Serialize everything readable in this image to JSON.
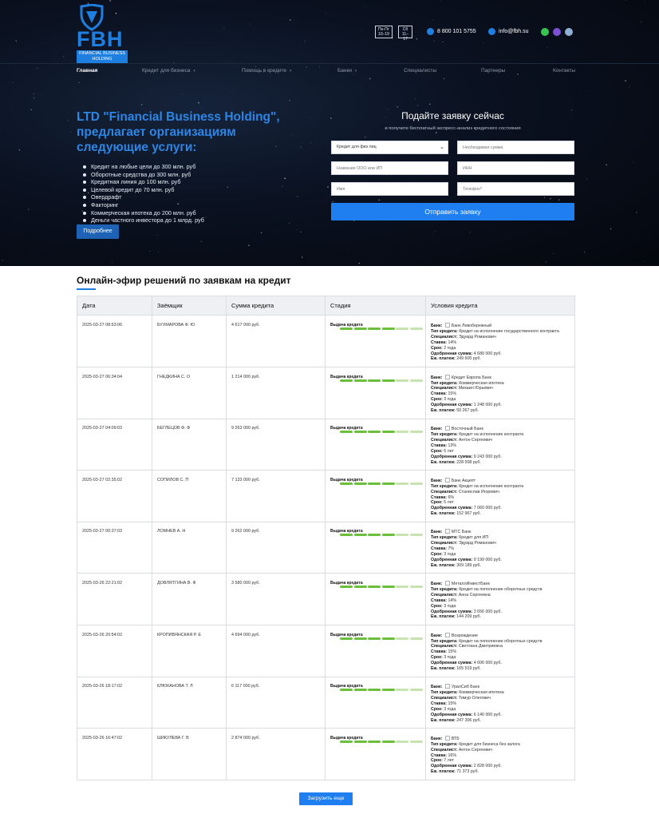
{
  "brand": {
    "logo_text": "FBH",
    "logo_sub": "FINANCIAL BUSINESS HOLDING",
    "accent": "#1f7fe0"
  },
  "header": {
    "hours_weekday_days": "Пн-Пт",
    "hours_weekday_time": "10–19",
    "hours_sat_days": "Сб",
    "hours_sat_time": "11–17",
    "phone": "8 800 101 5755",
    "email": "info@fbh.su",
    "social_icons": [
      "whatsapp-icon",
      "viber-icon",
      "telegram-icon"
    ]
  },
  "nav": {
    "items": [
      {
        "label": "Главная"
      },
      {
        "label": "Кредит для бизнеса"
      },
      {
        "label": "Помощь в кредите"
      },
      {
        "label": "Банки"
      },
      {
        "label": "Специалисты"
      },
      {
        "label": "Партнеры"
      },
      {
        "label": "Контакты"
      }
    ]
  },
  "hero": {
    "title": "LTD \"Financial Business Holding\", предлагает организациям следующие услуги:",
    "services": [
      "Кредит на любые цели до 300 млн. руб",
      "Оборотные средства до 300 млн. руб",
      "Кредитная линия до 100 млн. руб",
      "Целевой кредит до 70 млн. руб",
      "Овердрафт",
      "Факторинг",
      "Коммерческая ипотека до 200 млн. руб",
      "Деньги частного инвестора до 1 млрд. руб"
    ],
    "more_button": "Подробнее"
  },
  "form": {
    "title": "Подайте заявку сейчас",
    "subtitle": "и получите бесплатный экспресс-анализ кредитного состояния",
    "credit_type_value": "Кредит для физ лиц",
    "amount_placeholder": "Необходимая сумма",
    "company_placeholder": "Название ООО или ИП",
    "inn_placeholder": "ИНН",
    "name_placeholder": "Имя",
    "phone_placeholder": "Телефон*",
    "submit_label": "Отправить заявку"
  },
  "feed": {
    "title": "Онлайн-эфир решений по заявкам на кредит",
    "columns": [
      "Дата",
      "Заёмщик",
      "Сумма кредита",
      "Стадия",
      "Условия кредита"
    ],
    "labels": {
      "bank": "Банк:",
      "type": "Тип кредита:",
      "specialist": "Специалист:",
      "rate": "Ставка:",
      "term": "Срок:",
      "approved": "Одобренная сумма:",
      "payment": "Еж. платеж:"
    },
    "rows": [
      {
        "date": "2025-03-27 08:53:06",
        "borrower": "БУХМАРОВА Ф. Ю",
        "amount": "4 617 000 руб.",
        "stage": "Выдача кредита",
        "bank": "Банк Левобережный",
        "type": "Кредит на исполнение государственного контракта",
        "specialist": "Эдуард Романович",
        "rate": "14%",
        "term": "2 года",
        "approved": "4 680 000 руб.",
        "payment": "249 600 руб."
      },
      {
        "date": "2025-03-27 06:34:04",
        "borrower": "ГНЕДКИНА С. О",
        "amount": "1 214 000 руб.",
        "stage": "Выдача кредита",
        "bank": "Кредит Европа Банк",
        "type": "Коммерческая ипотека",
        "specialist": "Михаил Юрьевич",
        "rate": "15%",
        "term": "3 года",
        "approved": "1 248 000 руб.",
        "payment": "50 267 руб."
      },
      {
        "date": "2025-03-27 04:09:03",
        "borrower": "БЕГЛЕЦОВ Ф. Ф",
        "amount": "9 263 000 руб.",
        "stage": "Выдача кредита",
        "bank": "Восточный Банк",
        "type": "Кредит на исполнение контракта",
        "specialist": "Антон Сергеевич",
        "rate": "13%",
        "term": "6 лет",
        "approved": "9 243 000 руб.",
        "payment": "228 508 руб."
      },
      {
        "date": "2025-03-27 02:35:02",
        "borrower": "СОПИЛОВ С. П",
        "amount": "7 133 000 руб.",
        "stage": "Выдача кредита",
        "bank": "Банк Акцепт",
        "type": "Кредит на исполнение контракта",
        "specialist": "Станислав Игоревич",
        "rate": "6%",
        "term": "5 лет",
        "approved": "7 060 000 руб.",
        "payment": "152 967 руб."
      },
      {
        "date": "2025-03-27 00:37:03",
        "borrower": "ЛОМНЕВ А. Н",
        "amount": "9 262 000 руб.",
        "stage": "Выдача кредита",
        "bank": "МТС Банк",
        "type": "Кредит для ИП",
        "specialist": "Эдуард Романович",
        "rate": "7%",
        "term": "3 года",
        "approved": "9 199 000 руб.",
        "payment": "309 189 руб."
      },
      {
        "date": "2025-03-26 22:21:02",
        "borrower": "ДОВЛЯТГИНА В. Ф",
        "amount": "3 580 000 руб.",
        "stage": "Выдача кредита",
        "bank": "МеталлИнвестБанк",
        "type": "Кредит на пополнение оборотных средств",
        "specialist": "Анна Сергеевна",
        "rate": "14%",
        "term": "3 года",
        "approved": "3 656 000 руб.",
        "payment": "144 209 руб."
      },
      {
        "date": "2025-03-26 20:54:02",
        "borrower": "КРОПИВЯНСКАЯ Р. Е",
        "amount": "4 694 000 руб.",
        "stage": "Выдача кредита",
        "bank": "Возрождение",
        "type": "Кредит на пополнение оборотных средств",
        "specialist": "Светлана Дмитриевна",
        "rate": "15%",
        "term": "3 года",
        "approved": "4 606 000 руб.",
        "payment": "165 519 руб."
      },
      {
        "date": "2025-03-26 18:17:02",
        "borrower": "КЛЮКАНОВА Т. Л",
        "amount": "6 117 000 руб.",
        "stage": "Выдача кредита",
        "bank": "УралСиб Банк",
        "type": "Коммерческая ипотека",
        "specialist": "Тимур Олегович",
        "rate": "15%",
        "term": "3 года",
        "approved": "6 140 000 руб.",
        "payment": "247 306 руб."
      },
      {
        "date": "2025-03-26 16:47:02",
        "borrower": "ШИКУЛЕВА Г. В",
        "amount": "2 874 000 руб.",
        "stage": "Выдача кредита",
        "bank": "ВТБ",
        "type": "Кредит для бизнеса без залога",
        "specialist": "Антон Сергеевич",
        "rate": "16%",
        "term": "7 лет",
        "approved": "2 828 000 руб.",
        "payment": "71 373 руб."
      }
    ],
    "stage_progress": 0.6,
    "load_more": "Загрузить еще"
  }
}
